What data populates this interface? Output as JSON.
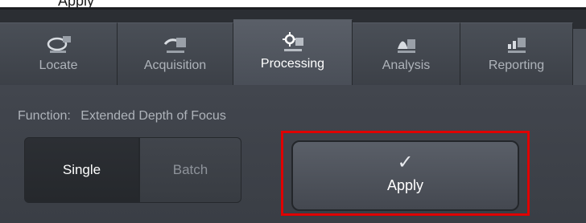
{
  "caption": {
    "top_text": "Apply"
  },
  "tabs": [
    {
      "label": "Locate",
      "icon": "microscope-icon"
    },
    {
      "label": "Acquisition",
      "icon": "camera-icon"
    },
    {
      "label": "Processing",
      "icon": "processing-icon",
      "active": true
    },
    {
      "label": "Analysis",
      "icon": "histogram-icon"
    },
    {
      "label": "Reporting",
      "icon": "report-icon"
    }
  ],
  "panel": {
    "function_label": "Function:",
    "function_value": "Extended Depth of Focus",
    "mode_single": "Single",
    "mode_batch": "Batch",
    "selected_mode": "Single",
    "apply_check": "✓",
    "apply_label": "Apply"
  },
  "colors": {
    "highlight": "#e00000",
    "chrome_dark": "#2b2e33",
    "panel": "#3b3f46",
    "active_text": "#ffffff",
    "inactive_text": "#aeb3ba"
  }
}
